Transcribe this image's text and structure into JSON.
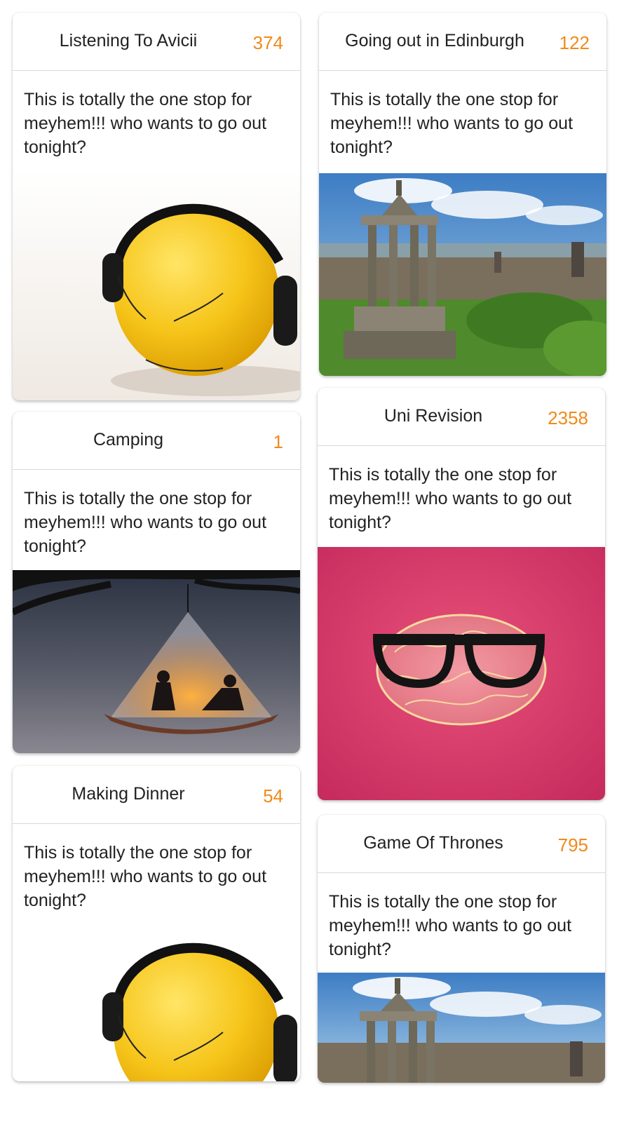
{
  "theme": {
    "count_color": "#f08a1c",
    "text_color": "#222222"
  },
  "cards": [
    {
      "title": "Listening To Avicii",
      "count": "374",
      "body": "This is totally the one stop for meyhem!!! who wants to go out tonight?",
      "image": "smiley-headphones"
    },
    {
      "title": "Going out in Edinburgh",
      "count": "122",
      "body": "This is totally the one stop for meyhem!!! who wants to go out tonight?",
      "image": "edinburgh-monument"
    },
    {
      "title": "Camping",
      "count": "1",
      "body": "This is totally the one stop for meyhem!!! who wants to go out tonight?",
      "image": "hanging-tent"
    },
    {
      "title": "Uni Revision",
      "count": "2358",
      "body": "This is totally the one stop for meyhem!!! who wants to go out tonight?",
      "image": "brain-glasses"
    },
    {
      "title": "Making Dinner",
      "count": "54",
      "body": "This is totally the one stop for meyhem!!! who wants to go out tonight?",
      "image": "smiley-headphones"
    },
    {
      "title": "Game Of Thrones",
      "count": "795",
      "body": "This is totally the one stop for meyhem!!! who wants to go out tonight?",
      "image": "edinburgh-monument"
    }
  ]
}
